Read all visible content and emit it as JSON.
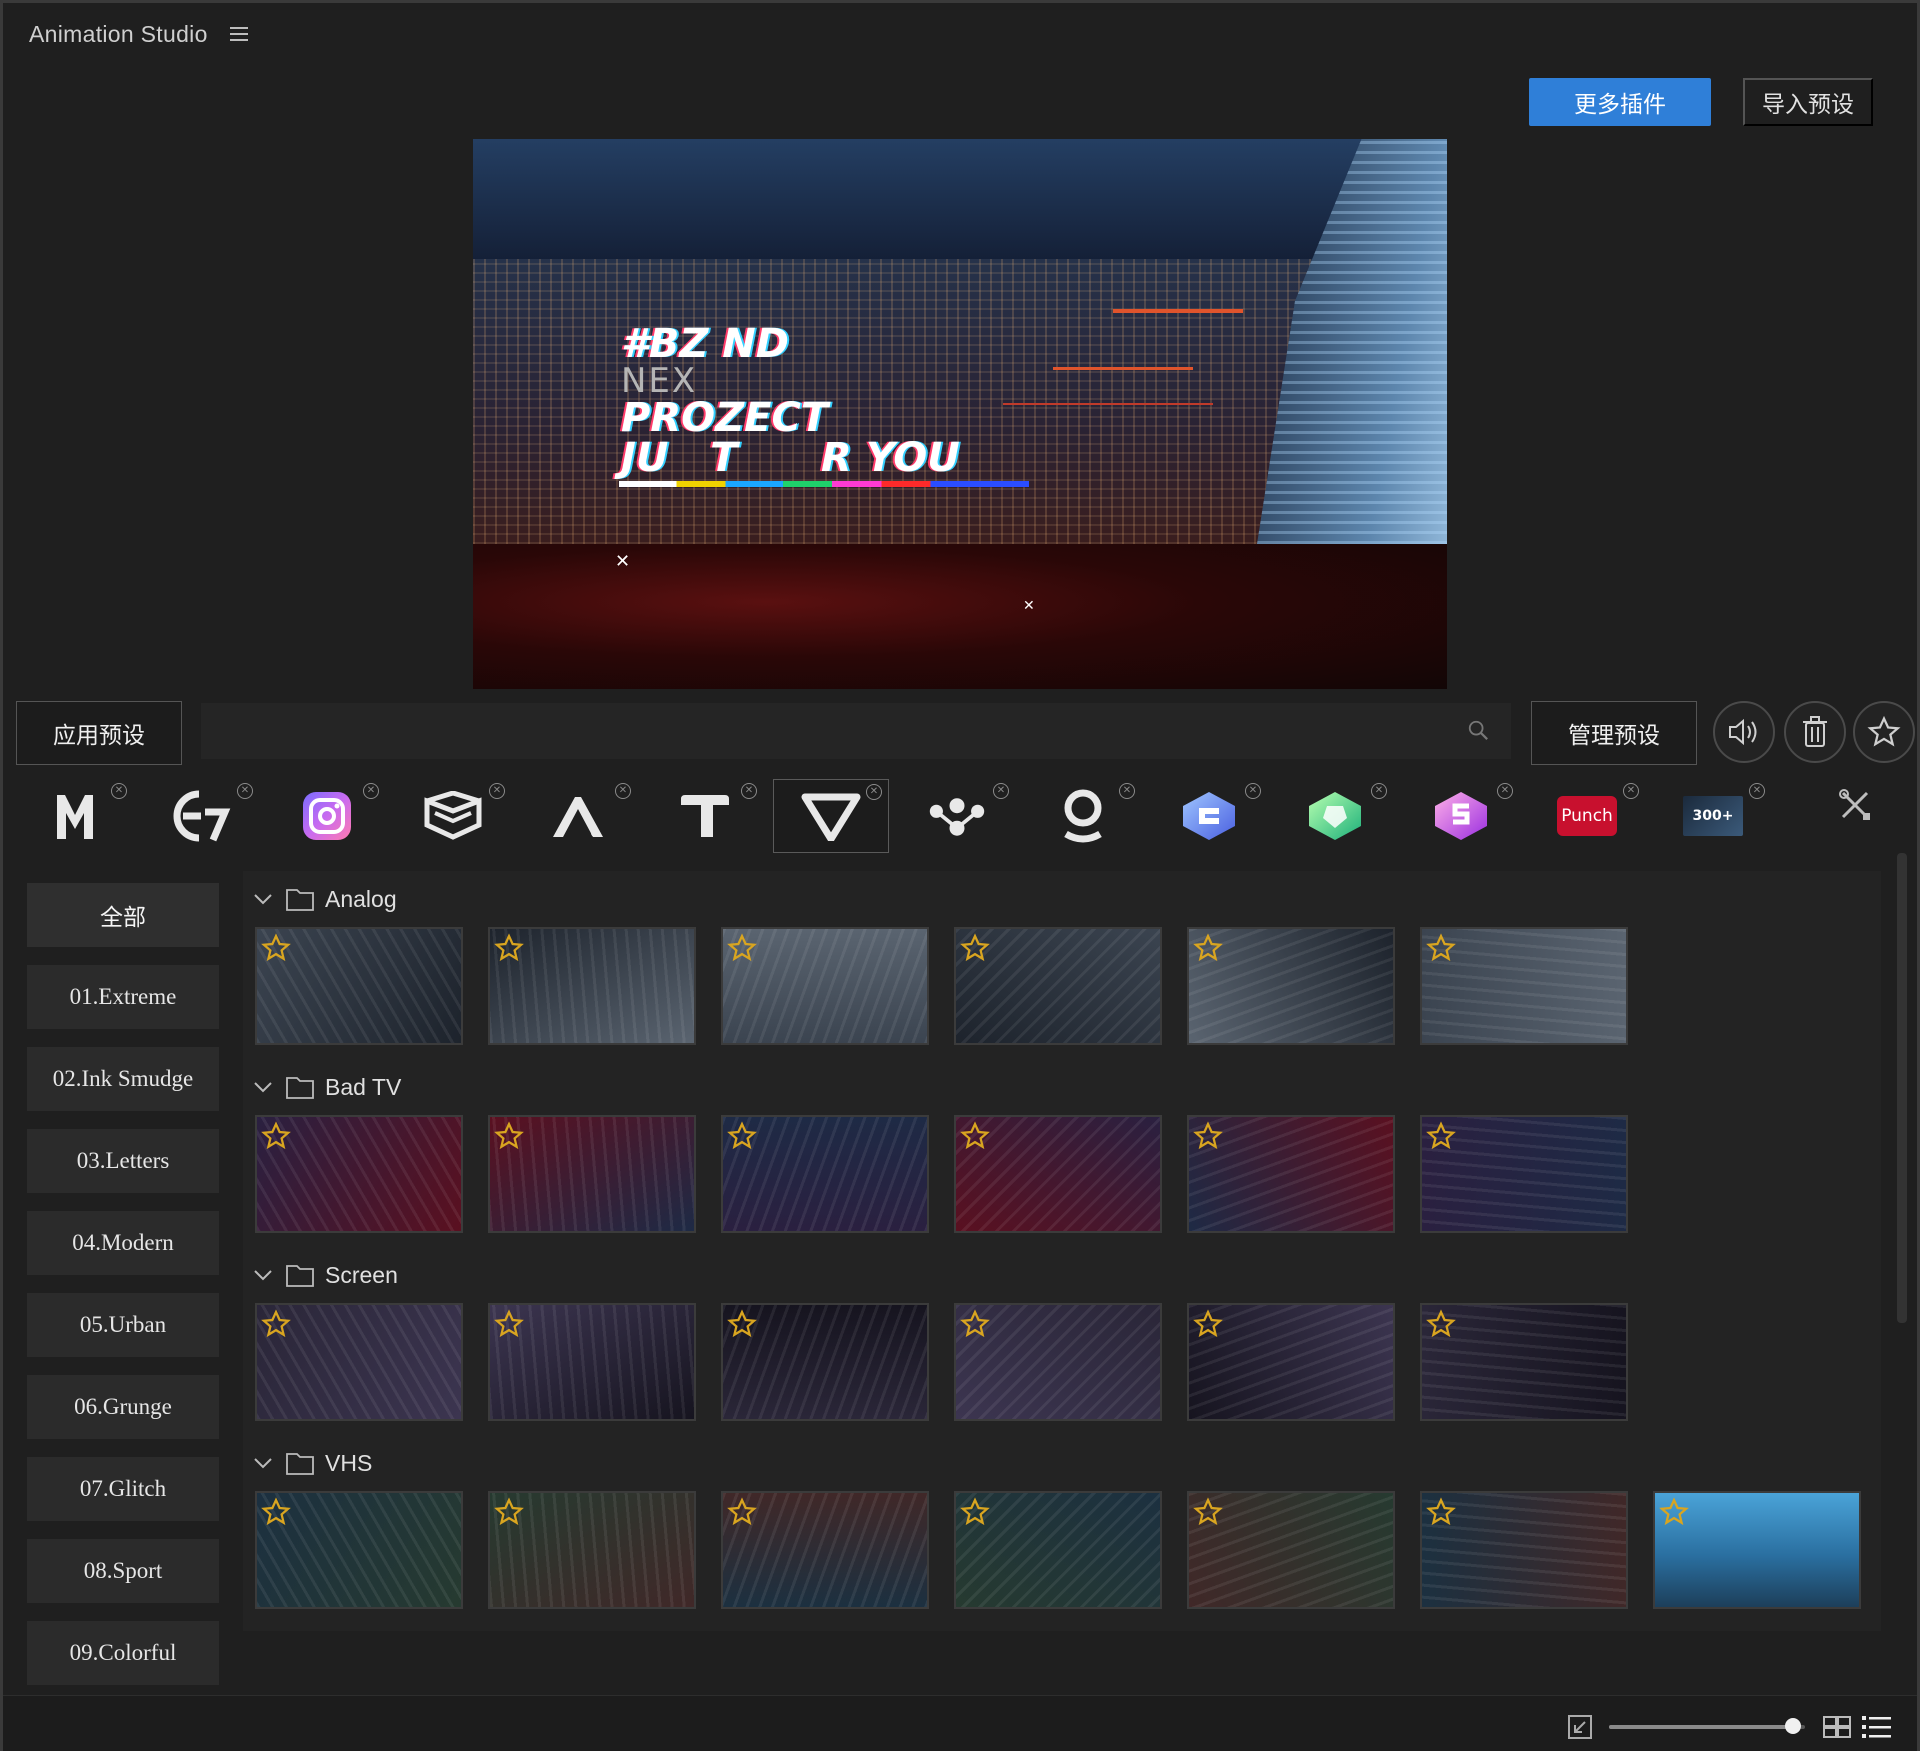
{
  "app": {
    "title": "Animation Studio"
  },
  "header": {
    "more_plugins": "更多插件",
    "import_preset": "导入预设"
  },
  "preview": {
    "lines": [
      "#BZ   ND",
      "NEX",
      "PROZECT",
      "JU   T      R YOU"
    ]
  },
  "toolbar": {
    "apply_preset": "应用预设",
    "search_placeholder": "",
    "manage_preset": "管理预设",
    "sound_icon": "speaker-icon",
    "delete_icon": "trash-icon",
    "favorite_icon": "star-icon"
  },
  "plugins": [
    {
      "name": "M",
      "icon": "m-logo-icon",
      "active": false
    },
    {
      "name": "E7",
      "icon": "e-logo-icon",
      "active": false
    },
    {
      "name": "Instagram",
      "icon": "instagram-icon",
      "active": false
    },
    {
      "name": "Layers",
      "icon": "layers-logo-icon",
      "active": false
    },
    {
      "name": "A",
      "icon": "a-logo-icon",
      "active": false
    },
    {
      "name": "T",
      "icon": "t-logo-icon",
      "active": false
    },
    {
      "name": "V",
      "icon": "v-logo-icon",
      "active": true
    },
    {
      "name": "Molecule",
      "icon": "molecule-icon",
      "active": false
    },
    {
      "name": "Pin",
      "icon": "pin-logo-icon",
      "active": false
    },
    {
      "name": "Blue Gem",
      "icon": "gem-blue-icon",
      "active": false
    },
    {
      "name": "Green Gem",
      "icon": "gem-green-icon",
      "active": false
    },
    {
      "name": "Pink Gem",
      "icon": "gem-pink-icon",
      "active": false
    },
    {
      "name": "Punch",
      "icon": "punch-logo-icon",
      "label": "Punch",
      "active": false
    },
    {
      "name": "300+",
      "icon": "300-logo-icon",
      "label": "300+",
      "active": false
    }
  ],
  "sidebar": {
    "items": [
      {
        "label": "全部",
        "selected": true
      },
      {
        "label": "01.Extreme"
      },
      {
        "label": "02.Ink Smudge"
      },
      {
        "label": "03.Letters"
      },
      {
        "label": "04.Modern"
      },
      {
        "label": "05.Urban"
      },
      {
        "label": "06.Grunge"
      },
      {
        "label": "07.Glitch"
      },
      {
        "label": "08.Sport"
      },
      {
        "label": "09.Colorful"
      }
    ]
  },
  "groups": [
    {
      "name": "Analog",
      "count": 6
    },
    {
      "name": "Bad TV",
      "count": 6
    },
    {
      "name": "Screen",
      "count": 6
    },
    {
      "name": "VHS",
      "count": 7
    }
  ],
  "colors": {
    "accent": "#2f7fd8",
    "background": "#1f1f1f",
    "panel": "#232323",
    "star": "#d9a520"
  },
  "bottombar": {
    "fit_icon": "fit-icon",
    "grid_icon": "grid-view-icon",
    "list_icon": "list-view-icon",
    "zoom": 0.94
  }
}
